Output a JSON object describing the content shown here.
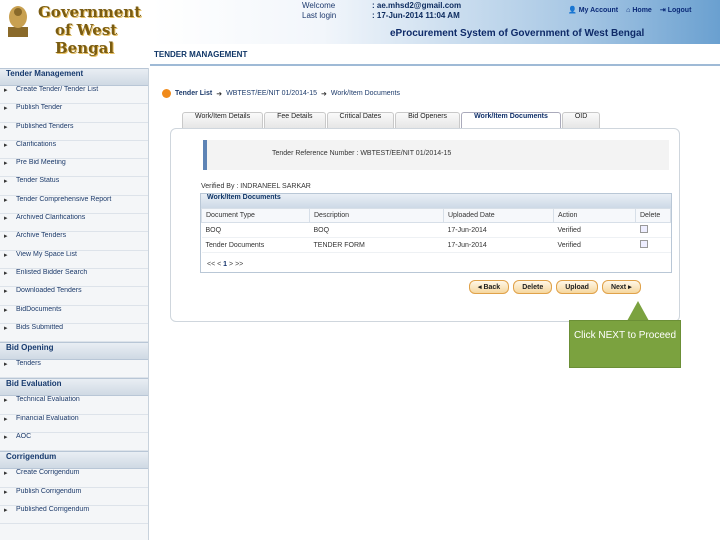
{
  "header": {
    "logo_line1": "Government",
    "logo_line2": "of West Bengal",
    "welcome_label": "Welcome",
    "welcome_value": ": ae.mhsd2@gmail.com",
    "last_login_label": "Last login",
    "last_login_value": ": 17-Jun-2014 11:04 AM",
    "links": {
      "my_account": "My Account",
      "home": "Home",
      "logout": "Logout"
    },
    "system_title": "eProcurement System of Government of West Bengal"
  },
  "sidebar": {
    "sections": [
      {
        "title": "Tender Management",
        "items": [
          "Create Tender/ Tender List",
          "Publish Tender",
          "Published Tenders",
          "Clarifications",
          "Pre Bid Meeting",
          "Tender Status",
          "Tender Comprehensive Report",
          "Archived Clarifications",
          "Archive Tenders",
          "View My Space List",
          "Enlisted Bidder Search",
          "Downloaded Tenders",
          "BidDocuments",
          "Bids Submitted"
        ]
      },
      {
        "title": "Bid Opening",
        "items": [
          "Tenders"
        ]
      },
      {
        "title": "Bid Evaluation",
        "items": [
          "Technical Evaluation",
          "Financial Evaluation",
          "AOC"
        ]
      },
      {
        "title": "Corrigendum",
        "items": [
          "Create Corrigendum",
          "Publish Corrigendum",
          "Published Corrigendum"
        ]
      }
    ]
  },
  "main": {
    "title": "TENDER MANAGEMENT",
    "breadcrumb": [
      "Tender List",
      "WBTEST/EE/NIT 01/2014-15",
      "Work/Item Documents"
    ],
    "tabs": [
      "Work/Item Details",
      "Fee Details",
      "Critical Dates",
      "Bid Openers",
      "Work/Item Documents",
      "OID"
    ],
    "active_tab": "Work/Item Documents",
    "reference": "Tender Reference Number : WBTEST/EE/NIT 01/2014-15",
    "verified_by": "Verified By : INDRANEEL SARKAR",
    "grid": {
      "title": "Work/Item Documents",
      "columns": [
        "Document Type",
        "Description",
        "Uploaded Date",
        "Action",
        "Delete"
      ],
      "rows": [
        [
          "BOQ",
          "BOQ",
          "17-Jun-2014",
          "Verified"
        ],
        [
          "Tender Documents",
          "TENDER FORM",
          "17-Jun-2014",
          "Verified"
        ]
      ],
      "pager_prefix": "<< <",
      "pager_page": "1",
      "pager_suffix": "> >>"
    },
    "buttons": {
      "back": "◂ Back",
      "delete": "Delete",
      "upload": "Upload",
      "next": "Next ▸"
    }
  },
  "callout": {
    "text": "Click NEXT to Proceed",
    "color": "#7ba23f"
  }
}
